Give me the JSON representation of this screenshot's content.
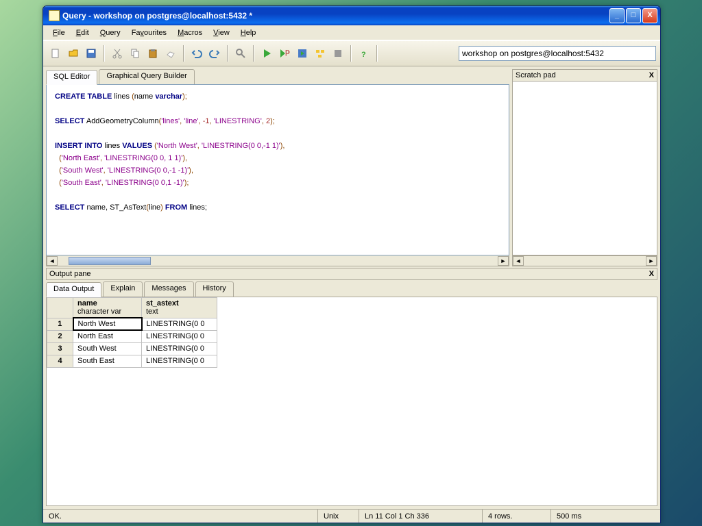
{
  "window": {
    "title": "Query - workshop on postgres@localhost:5432 *"
  },
  "menu": [
    "File",
    "Edit",
    "Query",
    "Favourites",
    "Macros",
    "View",
    "Help"
  ],
  "connection": "workshop on postgres@localhost:5432",
  "tabs": {
    "sql": "SQL Editor",
    "gqb": "Graphical Query Builder"
  },
  "scratch": {
    "title": "Scratch pad"
  },
  "sql": {
    "l1a": "CREATE TABLE",
    "l1b": " lines ",
    "l1c": "(",
    "l1d": "name ",
    "l1e": "varchar",
    "l1f": ");",
    "l2a": "SELECT",
    "l2b": " AddGeometryColumn",
    "l2c": "(",
    "l2d": "'lines'",
    "l2e": ", ",
    "l2f": "'line'",
    "l2g": ", ",
    "l2h": "-1",
    "l2i": ", ",
    "l2j": "'LINESTRING'",
    "l2k": ", ",
    "l2l": "2",
    "l2m": ");",
    "l3a": "INSERT INTO",
    "l3b": " lines ",
    "l3c": "VALUES",
    "l3d": " (",
    "l3e": "'North West'",
    "l3f": ", ",
    "l3g": "'LINESTRING(0 0,-1 1)'",
    "l3h": "),",
    "l4a": "  (",
    "l4b": "'North East'",
    "l4c": ", ",
    "l4d": "'LINESTRING(0 0, 1 1)'",
    "l4e": "),",
    "l5a": "  (",
    "l5b": "'South West'",
    "l5c": ", ",
    "l5d": "'LINESTRING(0 0,-1 -1)'",
    "l5e": "),",
    "l6a": "  (",
    "l6b": "'South East'",
    "l6c": ", ",
    "l6d": "'LINESTRING(0 0,1 -1)'",
    "l6e": ");",
    "l7a": "SELECT",
    "l7b": " name, ST_AsText",
    "l7c": "(",
    "l7d": "line",
    "l7e": ") ",
    "l7f": "FROM",
    "l7g": " lines;"
  },
  "output": {
    "pane_title": "Output pane",
    "tabs": [
      "Data Output",
      "Explain",
      "Messages",
      "History"
    ],
    "col1": {
      "name": "name",
      "type": "character var"
    },
    "col2": {
      "name": "st_astext",
      "type": "text"
    },
    "rows": [
      {
        "n": "1",
        "name": "North West",
        "txt": "LINESTRING(0 0"
      },
      {
        "n": "2",
        "name": "North East",
        "txt": "LINESTRING(0 0"
      },
      {
        "n": "3",
        "name": "South West",
        "txt": "LINESTRING(0 0"
      },
      {
        "n": "4",
        "name": "South East",
        "txt": "LINESTRING(0 0"
      }
    ]
  },
  "status": {
    "ok": "OK.",
    "mode": "Unix",
    "pos": "Ln 11 Col 1 Ch 336",
    "rows": "4 rows.",
    "time": "500 ms"
  }
}
